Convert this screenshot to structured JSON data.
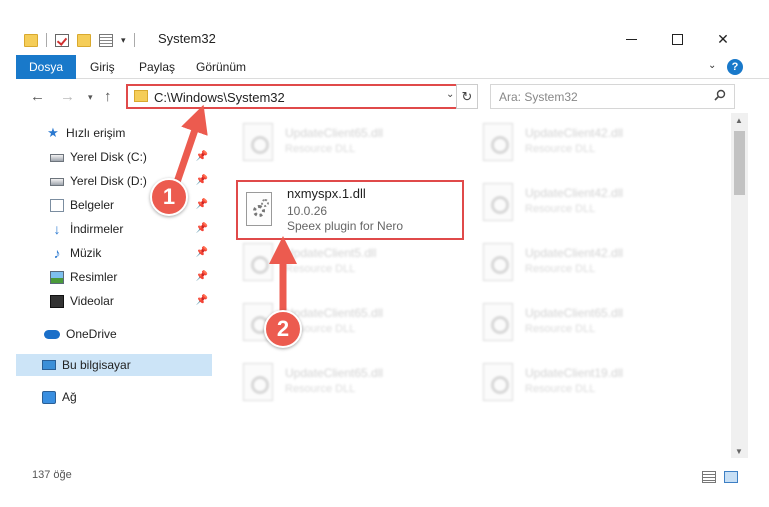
{
  "window": {
    "title": "System32",
    "minimize_glyph": "",
    "close_glyph": "✕"
  },
  "ribbon": {
    "tabs": [
      {
        "label": "Dosya",
        "active": true
      },
      {
        "label": "Giriş"
      },
      {
        "label": "Paylaş"
      },
      {
        "label": "Görünüm"
      }
    ],
    "help_label": "?"
  },
  "address": {
    "path": "C:\\Windows\\System32",
    "search_placeholder": "Ara: System32"
  },
  "nav": {
    "items": [
      {
        "label": "Hızlı erişim",
        "icon": "star-icon"
      },
      {
        "label": "Yerel Disk (C:)",
        "icon": "disk-icon",
        "pinned": true
      },
      {
        "label": "Yerel Disk (D:)",
        "icon": "disk-icon",
        "pinned": true
      },
      {
        "label": "Belgeler",
        "icon": "documents-icon",
        "pinned": true
      },
      {
        "label": "İndirmeler",
        "icon": "downloads-icon",
        "pinned": true
      },
      {
        "label": "Müzik",
        "icon": "music-icon",
        "pinned": true
      },
      {
        "label": "Resimler",
        "icon": "pictures-icon",
        "pinned": true
      },
      {
        "label": "Videolar",
        "icon": "videos-icon",
        "pinned": true
      },
      {
        "label": "OneDrive",
        "icon": "onedrive-icon"
      },
      {
        "label": "Bu bilgisayar",
        "icon": "computer-icon",
        "selected": true
      },
      {
        "label": "Ağ",
        "icon": "network-icon"
      }
    ]
  },
  "files": {
    "highlighted": {
      "name": "nxmyspx.1.dll",
      "version": "10.0.26",
      "description": "Speex plugin for Nero"
    },
    "background": [
      {
        "name": "UpdateClient65.dll",
        "desc": "Resource DLL"
      },
      {
        "name": "UpdateClient42.dll",
        "desc": "Resource DLL"
      },
      {
        "name": "UpdateClient42.dll",
        "desc": "Resource DLL"
      },
      {
        "name": "UpdateClient5.dll",
        "desc": "Resource DLL"
      },
      {
        "name": "UpdateClient42.dll",
        "desc": "Resource DLL"
      },
      {
        "name": "UpdateClient65.dll",
        "desc": "Resource DLL"
      },
      {
        "name": "UpdateClient65.dll",
        "desc": "Resource DLL"
      },
      {
        "name": "UpdateClient65.dll",
        "desc": "Resource DLL"
      },
      {
        "name": "UpdateClient19.dll",
        "desc": "Resource DLL"
      }
    ]
  },
  "status": {
    "count": "137 öğe"
  },
  "annotations": {
    "step1": "1",
    "step2": "2",
    "color": "#ec5b4f"
  }
}
